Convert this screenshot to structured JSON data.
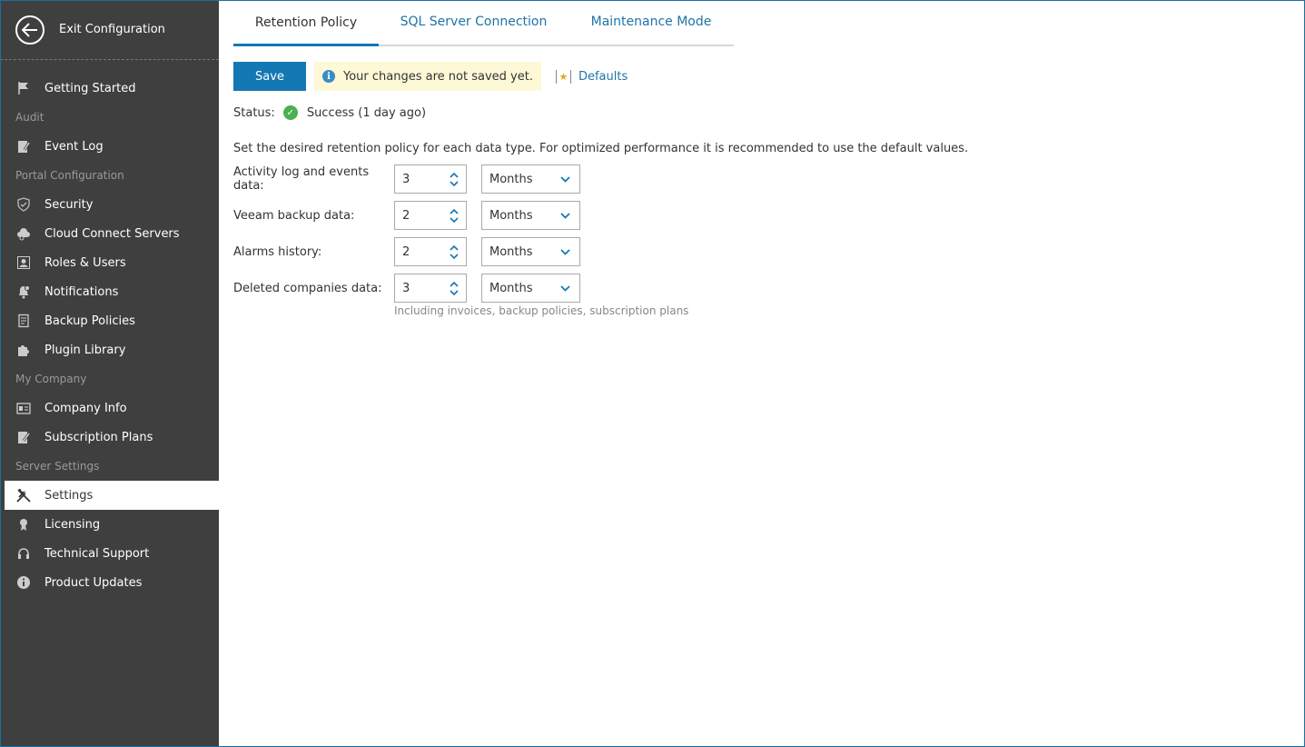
{
  "sidebar": {
    "exit_label": "Exit Configuration",
    "items": [
      {
        "type": "item",
        "label": "Getting Started",
        "icon": "flag-icon"
      },
      {
        "type": "group",
        "label": "Audit"
      },
      {
        "type": "item",
        "label": "Event Log",
        "icon": "event-log-icon"
      },
      {
        "type": "group",
        "label": "Portal Configuration"
      },
      {
        "type": "item",
        "label": "Security",
        "icon": "shield-icon"
      },
      {
        "type": "item",
        "label": "Cloud Connect Servers",
        "icon": "cloud-icon"
      },
      {
        "type": "item",
        "label": "Roles & Users",
        "icon": "user-icon"
      },
      {
        "type": "item",
        "label": "Notifications",
        "icon": "bell-icon"
      },
      {
        "type": "item",
        "label": "Backup Policies",
        "icon": "document-icon"
      },
      {
        "type": "item",
        "label": "Plugin Library",
        "icon": "puzzle-icon"
      },
      {
        "type": "group",
        "label": "My Company"
      },
      {
        "type": "item",
        "label": "Company Info",
        "icon": "id-card-icon"
      },
      {
        "type": "item",
        "label": "Subscription Plans",
        "icon": "pencil-doc-icon"
      },
      {
        "type": "group",
        "label": "Server Settings"
      },
      {
        "type": "item",
        "label": "Settings",
        "icon": "tools-icon",
        "active": true
      },
      {
        "type": "item",
        "label": "Licensing",
        "icon": "license-icon"
      },
      {
        "type": "item",
        "label": "Technical Support",
        "icon": "headset-icon"
      },
      {
        "type": "item",
        "label": "Product Updates",
        "icon": "info-icon"
      }
    ]
  },
  "tabs": [
    "Retention Policy",
    "SQL Server Connection",
    "Maintenance Mode"
  ],
  "toolbar": {
    "save_label": "Save",
    "notice": "Your changes are not saved yet.",
    "defaults_label": "Defaults"
  },
  "status": {
    "label": "Status:",
    "value": "Success (1 day ago)"
  },
  "description": "Set the desired retention policy for each data type. For optimized performance it is recommended to use the default values.",
  "rows": [
    {
      "label": "Activity log and events data:",
      "value": "3",
      "unit": "Months"
    },
    {
      "label": "Veeam backup data:",
      "value": "2",
      "unit": "Months"
    },
    {
      "label": "Alarms history:",
      "value": "2",
      "unit": "Months"
    },
    {
      "label": "Deleted companies data:",
      "value": "3",
      "unit": "Months"
    }
  ],
  "hint": "Including invoices, backup policies, subscription plans",
  "colors": {
    "accent": "#1478b4",
    "sidebar": "#3f3f3f",
    "notice_bg": "#fdf8d6",
    "success": "#4caf50"
  }
}
